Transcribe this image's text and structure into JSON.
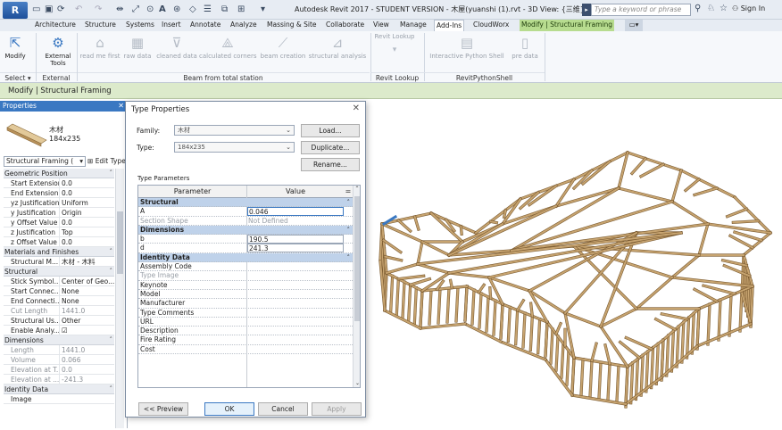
{
  "app": {
    "logo": "R",
    "title": "Autodesk Revit 2017 -  STUDENT VERSION -   木屋(yuanshi (1).rvt - 3D View: {三维}",
    "search_placeholder": "Type a keyword or phrase",
    "sign_in": "Sign In"
  },
  "tabs": [
    "Architecture",
    "Structure",
    "Systems",
    "Insert",
    "Annotate",
    "Analyze",
    "Massing & Site",
    "Collaborate",
    "View",
    "Manage",
    "Add-Ins",
    "CloudWorx",
    "Modify | Structural Framing"
  ],
  "ribbon": {
    "buttons": [
      "Modify",
      "External Tools",
      "read me first",
      "raw data",
      "cleaned data",
      "calculated corners",
      "beam creation",
      "structural analysis",
      "Revit Lookup",
      "Interactive Python Shell",
      "pre data"
    ],
    "panels": [
      "Select ▾",
      "External",
      "Beam from total station",
      "Revit Lookup",
      "RevitPythonShell"
    ]
  },
  "context_bar": "Modify | Structural Framing",
  "properties": {
    "header": "Properties",
    "type_line1": "木材",
    "type_line2": "184x235",
    "selector": "Structural Framing (",
    "edit_type": "Edit Type",
    "rows": [
      {
        "g": true,
        "k": "Geometric Position"
      },
      {
        "k": "Start Extension",
        "v": "0.0"
      },
      {
        "k": "End Extension",
        "v": "0.0"
      },
      {
        "k": "yz Justification",
        "v": "Uniform"
      },
      {
        "k": "y Justification",
        "v": "Origin"
      },
      {
        "k": "y Offset Value",
        "v": "0.0"
      },
      {
        "k": "z Justification",
        "v": "Top"
      },
      {
        "k": "z Offset Value",
        "v": "0.0"
      },
      {
        "g": true,
        "k": "Materials and Finishes"
      },
      {
        "k": "Structural M...",
        "v": "木材 - 木料"
      },
      {
        "g": true,
        "k": "Structural"
      },
      {
        "k": "Stick Symbol...",
        "v": "Center of Geo..."
      },
      {
        "k": "Start Connec...",
        "v": "None"
      },
      {
        "k": "End Connecti...",
        "v": "None"
      },
      {
        "k": "Cut Length",
        "v": "1441.0",
        "d": true
      },
      {
        "k": "Structural Us...",
        "v": "Other"
      },
      {
        "k": "Enable Analy...",
        "v": "☑"
      },
      {
        "g": true,
        "k": "Dimensions"
      },
      {
        "k": "Length",
        "v": "1441.0",
        "d": true
      },
      {
        "k": "Volume",
        "v": "0.066",
        "d": true
      },
      {
        "k": "Elevation at T...",
        "v": "0.0",
        "d": true
      },
      {
        "k": "Elevation at ...",
        "v": "-241.3",
        "d": true
      },
      {
        "g": true,
        "k": "Identity Data"
      },
      {
        "k": "Image",
        "v": ""
      }
    ]
  },
  "dialog": {
    "title": "Type Properties",
    "family_label": "Family:",
    "family_value": "木材",
    "type_label": "Type:",
    "type_value": "184x235",
    "load": "Load...",
    "duplicate": "Duplicate...",
    "rename": "Rename...",
    "type_parameters": "Type Parameters",
    "col_parameter": "Parameter",
    "col_value": "Value",
    "rows": [
      {
        "g": true,
        "k": "Structural"
      },
      {
        "k": "A",
        "v": "0.046",
        "s": "sel"
      },
      {
        "k": "Section Shape",
        "v": "Not Defined",
        "d": true
      },
      {
        "g": true,
        "k": "Dimensions"
      },
      {
        "k": "b",
        "v": "190.5",
        "s": "inp"
      },
      {
        "k": "d",
        "v": "241.3",
        "s": "inp"
      },
      {
        "g": true,
        "k": "Identity Data"
      },
      {
        "k": "Assembly Code",
        "v": ""
      },
      {
        "k": "Type Image",
        "v": "",
        "d": true
      },
      {
        "k": "Keynote",
        "v": ""
      },
      {
        "k": "Model",
        "v": ""
      },
      {
        "k": "Manufacturer",
        "v": ""
      },
      {
        "k": "Type Comments",
        "v": ""
      },
      {
        "k": "URL",
        "v": ""
      },
      {
        "k": "Description",
        "v": ""
      },
      {
        "k": "Fire Rating",
        "v": ""
      },
      {
        "k": "Cost",
        "v": ""
      }
    ],
    "preview": "<< Preview",
    "ok": "OK",
    "cancel": "Cancel",
    "apply": "Apply"
  },
  "colors": {
    "accent": "#3a78c2",
    "context_tab": "#b7dc8f",
    "beam": "#c7a470"
  }
}
